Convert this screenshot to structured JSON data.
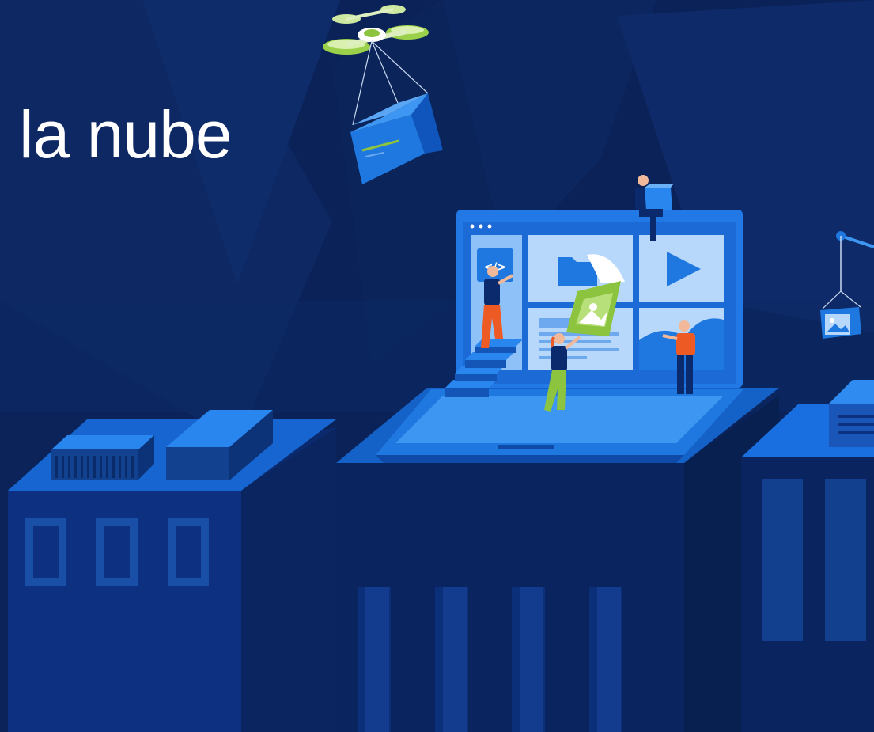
{
  "hero": {
    "headline": "la nube"
  },
  "colors": {
    "background": "#0a2257",
    "accent_blue": "#1f78e0",
    "accent_green": "#8cc43f",
    "figure_orange": "#ee5a24",
    "headline": "#ffffff"
  },
  "illustration": {
    "icons": [
      "drone-icon",
      "laptop-icon",
      "code-icon",
      "folder-icon",
      "play-icon",
      "image-icon"
    ]
  }
}
